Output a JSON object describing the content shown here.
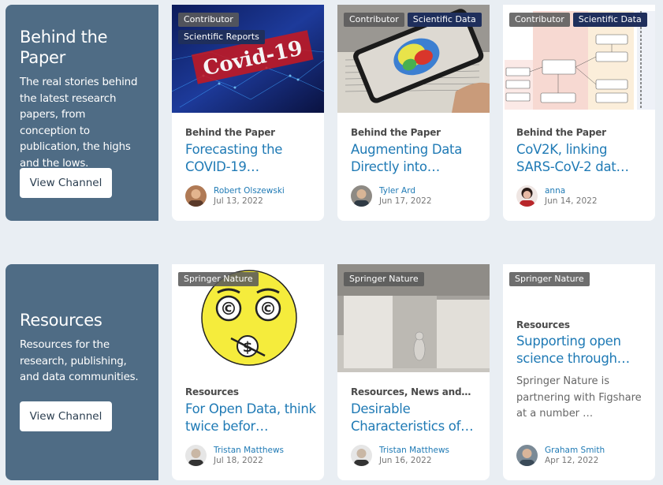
{
  "channels": [
    {
      "title": "Behind the Paper",
      "description": "The real stories behind the latest research papers, from conception to publication, the highs and the lows.",
      "button": "View Channel"
    },
    {
      "title": "Resources",
      "description": "Resources for the research, publishing, and data communities.",
      "button": "View Channel"
    }
  ],
  "cards": [
    {
      "tags": [
        "Contributor",
        "Scientific Reports"
      ],
      "category": "Behind the Paper",
      "title": "Forecasting the COVID-19…",
      "author": "Robert Olszewski",
      "date": "Jul 13, 2022",
      "image_text": "Covid-19"
    },
    {
      "tags": [
        "Contributor",
        "Scientific Data"
      ],
      "category": "Behind the Paper",
      "title": "Augmenting Data Directly into…",
      "author": "Tyler Ard",
      "date": "Jun 17, 2022"
    },
    {
      "tags": [
        "Contributor",
        "Scientific Data"
      ],
      "category": "Behind the Paper",
      "title": "CoV2K, linking SARS-CoV-2 dat…",
      "author": "anna",
      "date": "Jun 14, 2022"
    },
    {
      "tags": [
        "Springer Nature"
      ],
      "category": "Resources",
      "title": "For Open Data, think twice befor…",
      "author": "Tristan Matthews",
      "date": "Jul 18, 2022"
    },
    {
      "tags": [
        "Springer Nature"
      ],
      "category": "Resources, News and…",
      "title": "Desirable Characteristics of…",
      "author": "Tristan Matthews",
      "date": "Jun 16, 2022"
    },
    {
      "tags": [
        "Springer Nature"
      ],
      "category": "Resources",
      "title": "Supporting open science through…",
      "description": "Springer Nature is partnering with Figshare at a number …",
      "author": "Graham Smith",
      "date": "Apr 12, 2022"
    }
  ],
  "colors": {
    "channel_bg": "#4f6c85",
    "link": "#1f7ab5",
    "tag_navy": "#1f2f5c",
    "page_bg": "#e9eef3"
  }
}
